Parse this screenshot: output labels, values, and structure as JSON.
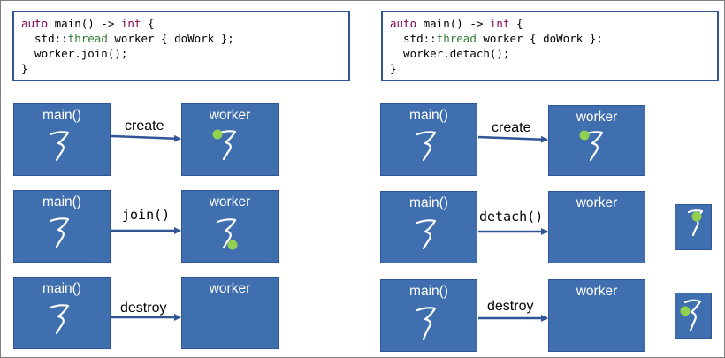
{
  "left": {
    "code": {
      "line1": {
        "kw1": "auto",
        "rest1": " main() -> ",
        "kw2": "int",
        "rest2": " {"
      },
      "line2": {
        "pre": "  std::",
        "ty": "thread",
        "post": " worker { doWork };"
      },
      "line3": "  worker.join();",
      "line4": "}"
    },
    "rows": [
      {
        "main": "main()",
        "worker": "worker",
        "action": "create"
      },
      {
        "main": "main()",
        "worker": "worker",
        "action": "join()"
      },
      {
        "main": "main()",
        "worker": "worker",
        "action": "destroy"
      }
    ]
  },
  "right": {
    "code": {
      "line1": {
        "kw1": "auto",
        "rest1": " main() -> ",
        "kw2": "int",
        "rest2": " {"
      },
      "line2": {
        "pre": "  std::",
        "ty": "thread",
        "post": " worker { doWork };"
      },
      "line3": "  worker.detach();",
      "line4": "}"
    },
    "rows": [
      {
        "main": "main()",
        "worker": "worker",
        "action": "create"
      },
      {
        "main": "main()",
        "worker": "worker",
        "action": "detach()"
      },
      {
        "main": "main()",
        "worker": "worker",
        "action": "destroy"
      }
    ]
  },
  "colors": {
    "box": "#3f6faf",
    "border": "#2f5597",
    "dot": "#92d050",
    "arrow": "#2f5597"
  },
  "icons": {
    "thread": "thread-squiggle-icon",
    "execution": "execution-dot-icon"
  }
}
